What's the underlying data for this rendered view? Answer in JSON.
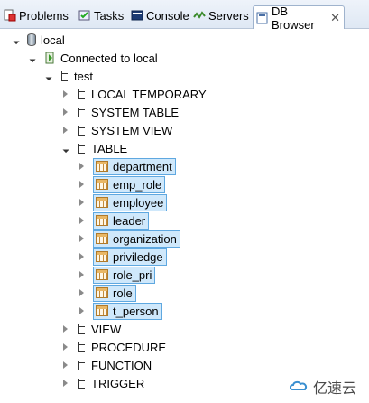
{
  "tabs": [
    {
      "label": "Problems",
      "icon": "problems-icon"
    },
    {
      "label": "Tasks",
      "icon": "tasks-icon"
    },
    {
      "label": "Console",
      "icon": "console-icon"
    },
    {
      "label": "Servers",
      "icon": "servers-icon"
    },
    {
      "label": "DB Browser",
      "icon": "db-browser-icon",
      "active": true
    }
  ],
  "tree": {
    "root": "local",
    "connection": "Connected to local",
    "schema": "test",
    "folders": {
      "local_temporary": "LOCAL TEMPORARY",
      "system_table": "SYSTEM TABLE",
      "system_view": "SYSTEM VIEW",
      "table": "TABLE",
      "view": "VIEW",
      "procedure": "PROCEDURE",
      "function": "FUNCTION",
      "trigger": "TRIGGER"
    },
    "tables": [
      "department",
      "emp_role",
      "employee",
      "leader",
      "organization",
      "priviledge",
      "role_pri",
      "role",
      "t_person"
    ]
  },
  "watermark": "亿速云",
  "colors": {
    "selection_bg": "#cfe8fb",
    "selection_border": "#5fa8e0"
  }
}
